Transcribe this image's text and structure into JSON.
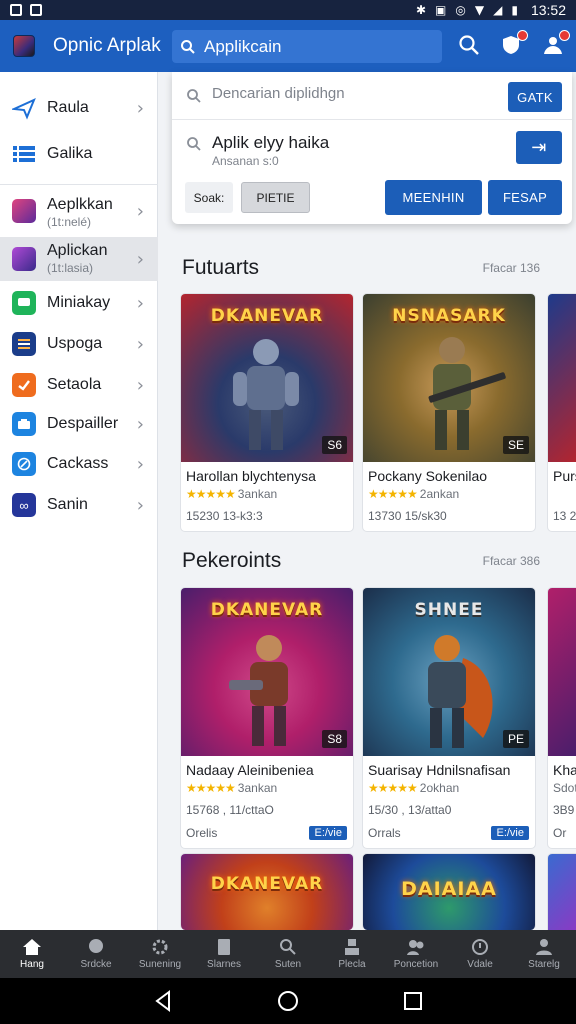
{
  "status_bar": {
    "time": "13:52"
  },
  "app": {
    "title": "Opnic Arplak"
  },
  "search": {
    "value": "Applikcain"
  },
  "dropdown": {
    "placeholder": "Dencarian diplidhgn",
    "go_label": "GATK",
    "suggestion_title": "Aplik elyy haika",
    "suggestion_sub": "Ansanan s:0",
    "suggestion_action": "⇥",
    "chips": [
      "Soak:",
      "PIETIE"
    ],
    "buttons": [
      "MEENHIN",
      "FESAP"
    ]
  },
  "sidebar": {
    "items": [
      {
        "label": "Raula",
        "sub": "",
        "icon": "plane-icon",
        "color": "#1d6fd6"
      },
      {
        "label": "Galika",
        "sub": "",
        "icon": "list-icon",
        "color": "#1d6fd6"
      },
      {
        "label": "Aeplkkan",
        "sub": "(1t:nelé)",
        "icon": "game-thumb-icon",
        "color": "#c0317f"
      },
      {
        "label": "Aplickan",
        "sub": "(1t:lasia)",
        "icon": "game-thumb-icon",
        "color": "#8a3ac4"
      },
      {
        "label": "Miniakay",
        "sub": "",
        "icon": "chat-icon",
        "color": "#1fb45a"
      },
      {
        "label": "Uspoga",
        "sub": "",
        "icon": "stack-icon",
        "color": "#1b3d8a"
      },
      {
        "label": "Setaola",
        "sub": "",
        "icon": "check-icon",
        "color": "#ef6c1e"
      },
      {
        "label": "Despailler",
        "sub": "",
        "icon": "store-icon",
        "color": "#1d84e0"
      },
      {
        "label": "Cackass",
        "sub": "",
        "icon": "compass-icon",
        "color": "#1d84e0"
      },
      {
        "label": "Sanin",
        "sub": "",
        "icon": "infinity-icon",
        "color": "#25369a"
      }
    ]
  },
  "sections": [
    {
      "title": "Futuarts",
      "more": "Ffacar 136",
      "cards": [
        {
          "art_title": "DKANEVAR",
          "badge": "S6",
          "name": "Harollan blychtenysa",
          "rating": "3ankan",
          "stars": "★★★★★",
          "stats": "15230 13-k3:3",
          "extra": "",
          "tag": "",
          "c1": "#1e3a8a",
          "c2": "#b3252f"
        },
        {
          "art_title": "NSNASARK",
          "badge": "SE",
          "name": "Pockany Sokenilao",
          "rating": "2ankan",
          "stars": "★★★★★",
          "stats": "13730 15/sk30",
          "extra": "",
          "tag": "",
          "c1": "#8a6b2e",
          "c2": "#3b3f2f"
        }
      ]
    },
    {
      "title": "Pekeroints",
      "more": "Ffacar 386",
      "cards": [
        {
          "art_title": "DKANEVAR",
          "badge": "S8",
          "name": "Nadaay Aleinibeniea",
          "rating": "3ankan",
          "stars": "★★★★★",
          "stats": "15768 , 11/cttaO",
          "extra": "Orelis",
          "tag": "E:/vie",
          "c1": "#b01f6a",
          "c2": "#4a1e6b"
        },
        {
          "art_title": "SHNEE",
          "badge": "PE",
          "name": "Suarisay Hdnilsnafisan",
          "rating": "2okhan",
          "stars": "★★★★★",
          "stats": "15/30 , 13/atta0",
          "extra": "Orrals",
          "tag": "E:/vie",
          "c1": "#2e6a8e",
          "c2": "#c8561a"
        }
      ]
    }
  ],
  "row3": [
    {
      "art_title": "DKANEVAR",
      "c1": "#c1401a",
      "c2": "#6b1f7a"
    },
    {
      "art_title": "DAIAIAA",
      "c1": "#1d4b9a",
      "c2": "#2e9a6b"
    }
  ],
  "peek": [
    {
      "name": "Purs",
      "stats": "13 2",
      "c1": "#1e3a8a"
    },
    {
      "name": "Kha",
      "stats": "3B9",
      "extra": "Or",
      "rating": "Sdot",
      "c1": "#b01f6a"
    }
  ],
  "bottom_nav": {
    "items": [
      {
        "label": "Hang",
        "icon": "home-icon"
      },
      {
        "label": "Srdcke",
        "icon": "chat-bubble-icon"
      },
      {
        "label": "Sunening",
        "icon": "gear-icon"
      },
      {
        "label": "Slarnes",
        "icon": "note-icon"
      },
      {
        "label": "Suten",
        "icon": "search-icon"
      },
      {
        "label": "Plecla",
        "icon": "person-icon"
      },
      {
        "label": "Poncetion",
        "icon": "group-icon"
      },
      {
        "label": "Vdale",
        "icon": "circle-icon"
      },
      {
        "label": "Starelg",
        "icon": "profile-icon"
      }
    ]
  }
}
